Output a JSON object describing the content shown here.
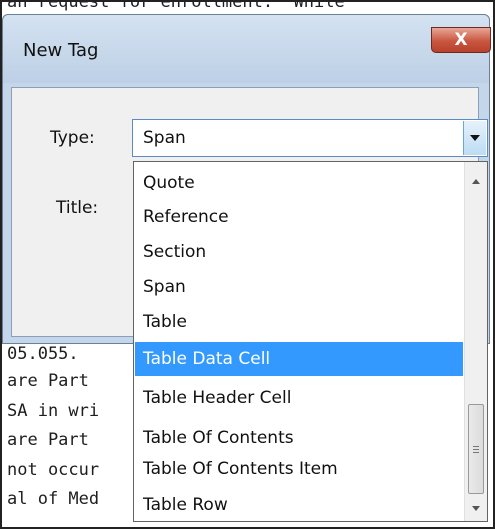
{
  "background_lines": [
    "an request for enrollment.  While",
    "                                  ",
    "05.055.",
    "are Part",
    "SA in wri",
    "are Part",
    "not occur",
    "al of Med"
  ],
  "dialog": {
    "title": "New Tag",
    "close_label": "X",
    "type_label": "Type:",
    "title_label": "Title:",
    "type_value": "Span"
  },
  "dropdown": {
    "selected": "Table Data Cell",
    "items": [
      "Quote",
      "Reference",
      "Section",
      "Span",
      "Table",
      "Table Data Cell",
      "Table Header Cell",
      "Table Of Contents",
      "Table Of Contents Item",
      "Table Row"
    ]
  },
  "colors": {
    "selection": "#3399ff",
    "dialog_frame": "#c4d6ea",
    "close_button": "#c8563f"
  },
  "icons": {
    "close": "close-icon",
    "combo_arrow": "chevron-down-icon",
    "scroll_up": "scroll-up-arrow-icon",
    "scroll_down": "scroll-down-arrow-icon"
  }
}
